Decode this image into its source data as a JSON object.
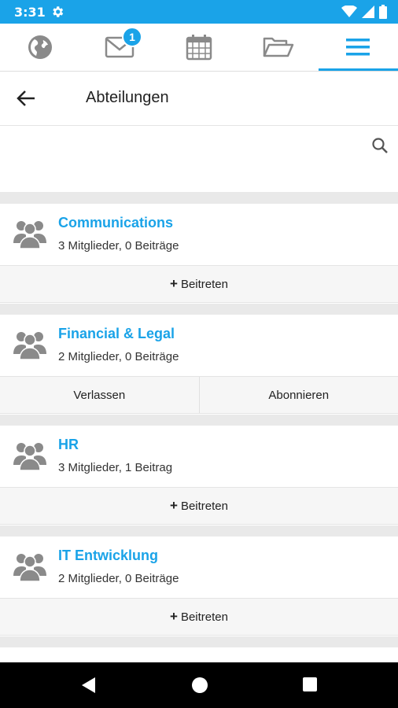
{
  "status": {
    "time": "3:31"
  },
  "tabs": {
    "inbox_badge": "1"
  },
  "header": {
    "title": "Abteilungen"
  },
  "search": {
    "placeholder": "",
    "value": ""
  },
  "departments": [
    {
      "name": "Communications",
      "meta": "3 Mitglieder, 0 Beiträge",
      "action": "Beitreten"
    },
    {
      "name": "Financial & Legal",
      "meta": "2 Mitglieder, 0 Beiträge",
      "action_left": "Verlassen",
      "action_right": "Abonnieren"
    },
    {
      "name": "HR",
      "meta": "3 Mitglieder, 1 Beitrag",
      "action": "Beitreten"
    },
    {
      "name": "IT Entwicklung",
      "meta": "2 Mitglieder, 0 Beiträge",
      "action": "Beitreten"
    }
  ],
  "plus_symbol": "+",
  "colors": {
    "accent": "#1aa3e8",
    "icon_gray": "#8a8a8a"
  }
}
